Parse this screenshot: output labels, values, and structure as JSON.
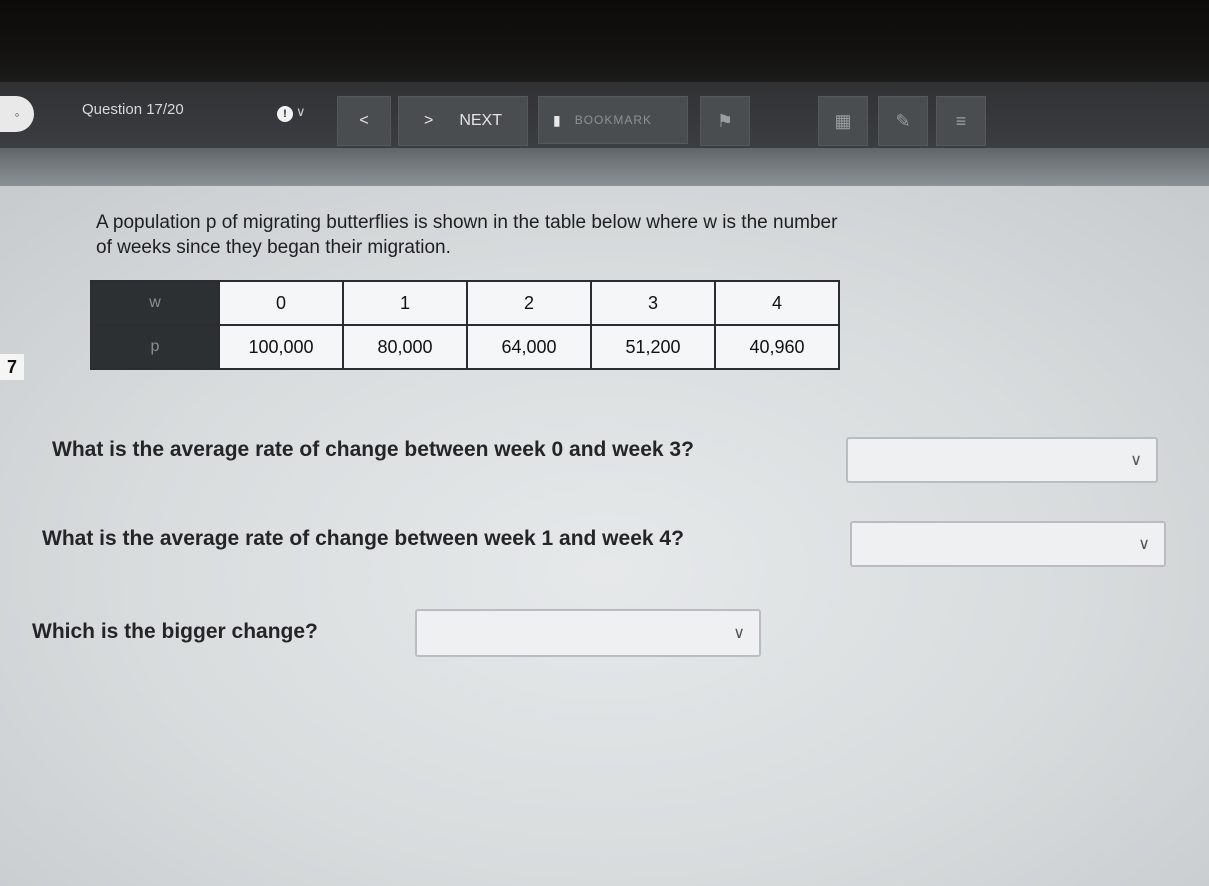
{
  "toolbar": {
    "menu_icon": "circle-dot-icon",
    "question_label": "Question 17/20",
    "info_icon": "info-icon",
    "prev_label": "<",
    "next_label": "NEXT",
    "next_arrow": ">",
    "bookmark_icon": "bookmark-icon",
    "bookmark_label": "BOOKMARK",
    "tool_icons": [
      "flag-icon",
      "calculator-icon",
      "eraser-icon",
      "menu-icon"
    ]
  },
  "question": {
    "number": "7",
    "prompt": "A population p of migrating butterflies is shown in the table below where w is the number of weeks since they began their migration.",
    "table": {
      "rows": [
        {
          "header": "w",
          "cells": [
            "0",
            "1",
            "2",
            "3",
            "4"
          ]
        },
        {
          "header": "p",
          "cells": [
            "100,000",
            "80,000",
            "64,000",
            "51,200",
            "40,960"
          ]
        }
      ]
    },
    "parts": [
      {
        "text": "What is the average rate of change between week 0 and week 3?",
        "value": ""
      },
      {
        "text": "What is the average rate of change between week 1 and week 4?",
        "value": ""
      },
      {
        "text": "Which is the bigger change?",
        "value": ""
      }
    ]
  }
}
